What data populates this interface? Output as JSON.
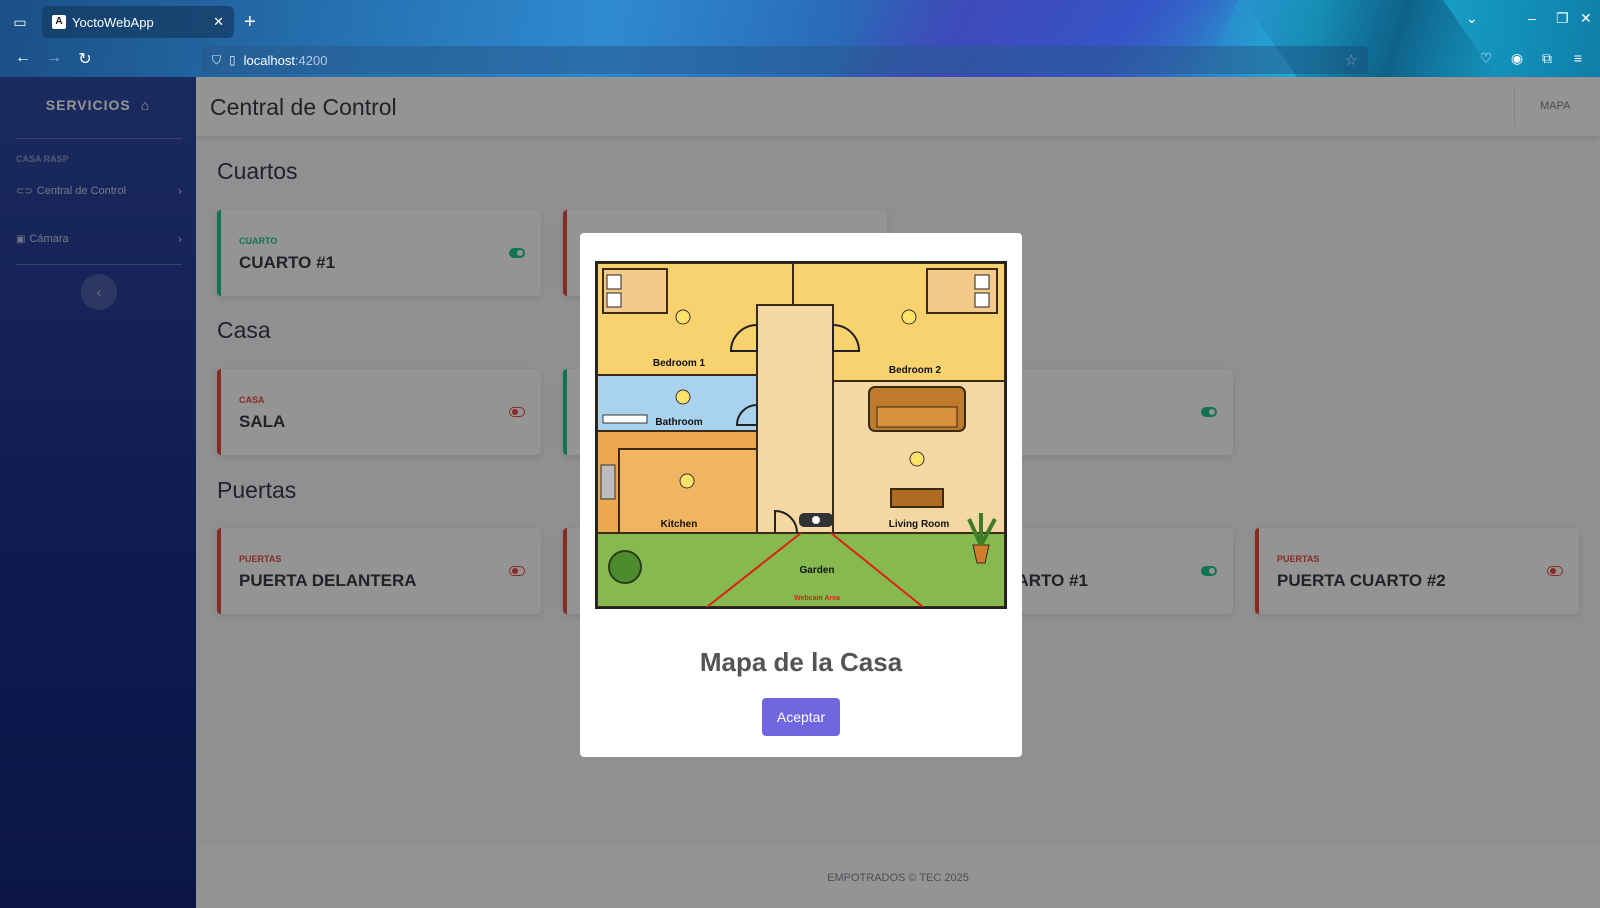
{
  "browser": {
    "tab_title": "YoctoWebApp",
    "favicon_letter": "A",
    "url_host": "localhost",
    "url_port": ":4200"
  },
  "sidebar": {
    "brand": "SERVICIOS",
    "heading": "CASA RASP",
    "items": [
      {
        "label": "Central de Control",
        "icon": "control-icon"
      },
      {
        "label": "Cámara",
        "icon": "camera-icon"
      }
    ]
  },
  "topbar": {
    "title": "Central de Control",
    "link": "MAPA"
  },
  "sections": {
    "cuartos": {
      "title": "Cuartos",
      "cards": [
        {
          "category": "CUARTO",
          "name": "CUARTO #1",
          "state": "on"
        }
      ]
    },
    "casa": {
      "title": "Casa",
      "cards": [
        {
          "category": "CASA",
          "name": "SALA",
          "state": "off"
        }
      ]
    },
    "puertas": {
      "title": "Puertas",
      "cards": [
        {
          "category": "PUERTAS",
          "name": "PUERTA DELANTERA",
          "state": "off"
        },
        {
          "category": "",
          "name": "JARTO #1",
          "state": "on"
        },
        {
          "category": "PUERTAS",
          "name": "PUERTA CUARTO #2",
          "state": "off"
        }
      ]
    }
  },
  "footer": {
    "text": "EMPOTRADOS © TEC 2025"
  },
  "modal": {
    "title": "Mapa de la Casa",
    "button": "Aceptar",
    "map_labels": {
      "bedroom1": "Bedroom 1",
      "bedroom2": "Bedroom 2",
      "bathroom": "Bathroom",
      "kitchen": "Kitchen",
      "living_room": "Living Room",
      "garden": "Garden",
      "webcam": "Webcam Area"
    }
  },
  "colors": {
    "success": "#1cc88a",
    "danger": "#e74a3b",
    "primary_button": "#7066e0",
    "sidebar": "#1a2f8a"
  }
}
